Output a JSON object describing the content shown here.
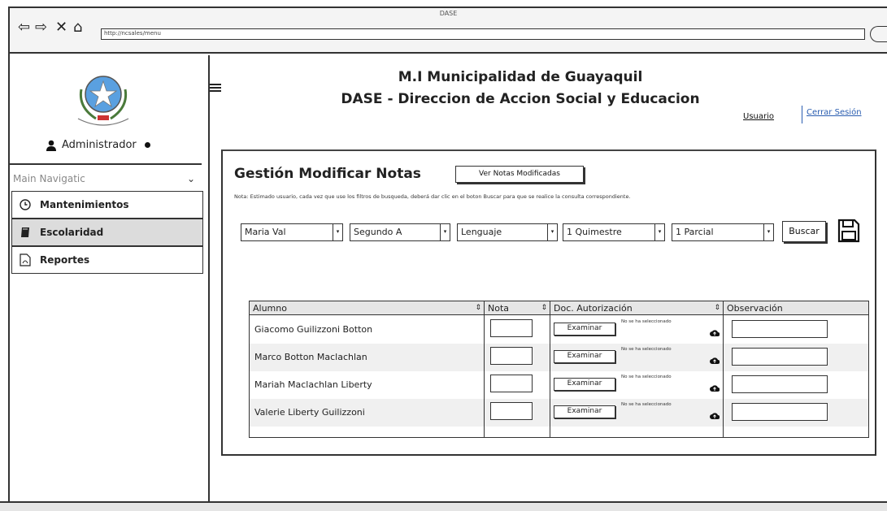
{
  "window": {
    "title": "DASE",
    "url": "http://ncsales/menu"
  },
  "sidebar": {
    "user": "Administrador",
    "nav_label": "Main Navigatic",
    "items": [
      {
        "label": "Mantenimientos",
        "icon": "clock-icon"
      },
      {
        "label": "Escolaridad",
        "icon": "book-icon",
        "active": true
      },
      {
        "label": "Reportes",
        "icon": "pdf-icon"
      }
    ]
  },
  "header": {
    "line1": "M.I Municipalidad de Guayaquil",
    "line2": "DASE - Direccion de Accion Social y Educacion",
    "user_link": "Usuario",
    "logout_link": "Cerrar Sesión"
  },
  "panel": {
    "title": "Gestión Modificar Notas",
    "view_button": "Ver Notas Modificadas",
    "note": "Nota: Estimado usuario, cada vez que use los filtros de busqueda, deberá dar clic en el boton Buscar para que se realice la consulta correspondiente.",
    "filters": [
      "Maria Val",
      "Segundo A",
      "Lenguaje",
      "1 Quimestre",
      "1 Parcial"
    ],
    "search_button": "Buscar"
  },
  "table": {
    "headers": [
      "Alumno",
      "Nota",
      "Doc. Autorización",
      "Observación"
    ],
    "examine_label": "Examinar",
    "no_file_label": "No se ha seleccionado",
    "rows": [
      {
        "alumno": "Giacomo Guilizzoni Botton"
      },
      {
        "alumno": "Marco Botton Maclachlan"
      },
      {
        "alumno": "Mariah Maclachlan Liberty"
      },
      {
        "alumno": "Valerie Liberty Guilizzoni"
      }
    ]
  }
}
